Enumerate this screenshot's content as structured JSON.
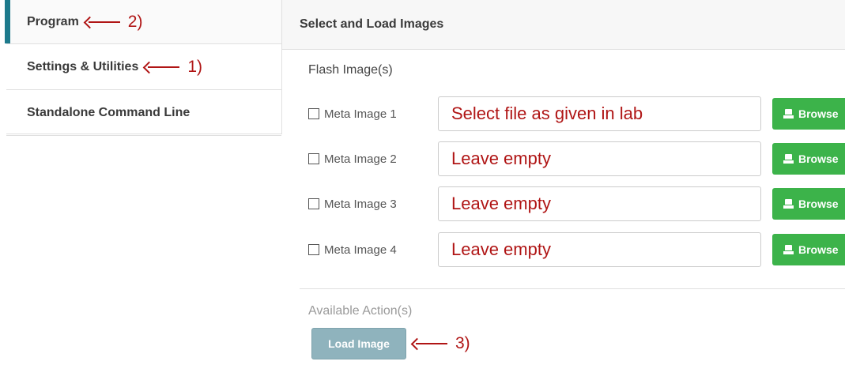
{
  "sidebar": {
    "items": [
      {
        "label": "Program",
        "annotation": "2)",
        "active": true
      },
      {
        "label": "Settings & Utilities",
        "annotation": "1)",
        "active": false
      },
      {
        "label": "Standalone Command Line",
        "annotation": "",
        "active": false
      }
    ]
  },
  "main": {
    "header": "Select and Load Images",
    "section_title": "Flash Image(s)",
    "images": [
      {
        "label": "Meta Image 1",
        "value": "Select file as given in lab",
        "checked": false,
        "browse_label": "Browse"
      },
      {
        "label": "Meta Image 2",
        "value": "Leave empty",
        "checked": false,
        "browse_label": "Browse"
      },
      {
        "label": "Meta Image 3",
        "value": "Leave empty",
        "checked": false,
        "browse_label": "Browse"
      },
      {
        "label": "Meta Image 4",
        "value": "Leave empty",
        "checked": false,
        "browse_label": "Browse"
      }
    ],
    "actions_title": "Available Action(s)",
    "load_button": "Load Image",
    "load_annotation": "3)"
  },
  "colors": {
    "accent": "#1d7a8c",
    "browse_green": "#3cb34a",
    "annotation_red": "#b01515",
    "load_button": "#8fb3bd"
  },
  "icons": {
    "browse": "drive-icon",
    "annotation_arrow": "arrow-left-icon"
  }
}
